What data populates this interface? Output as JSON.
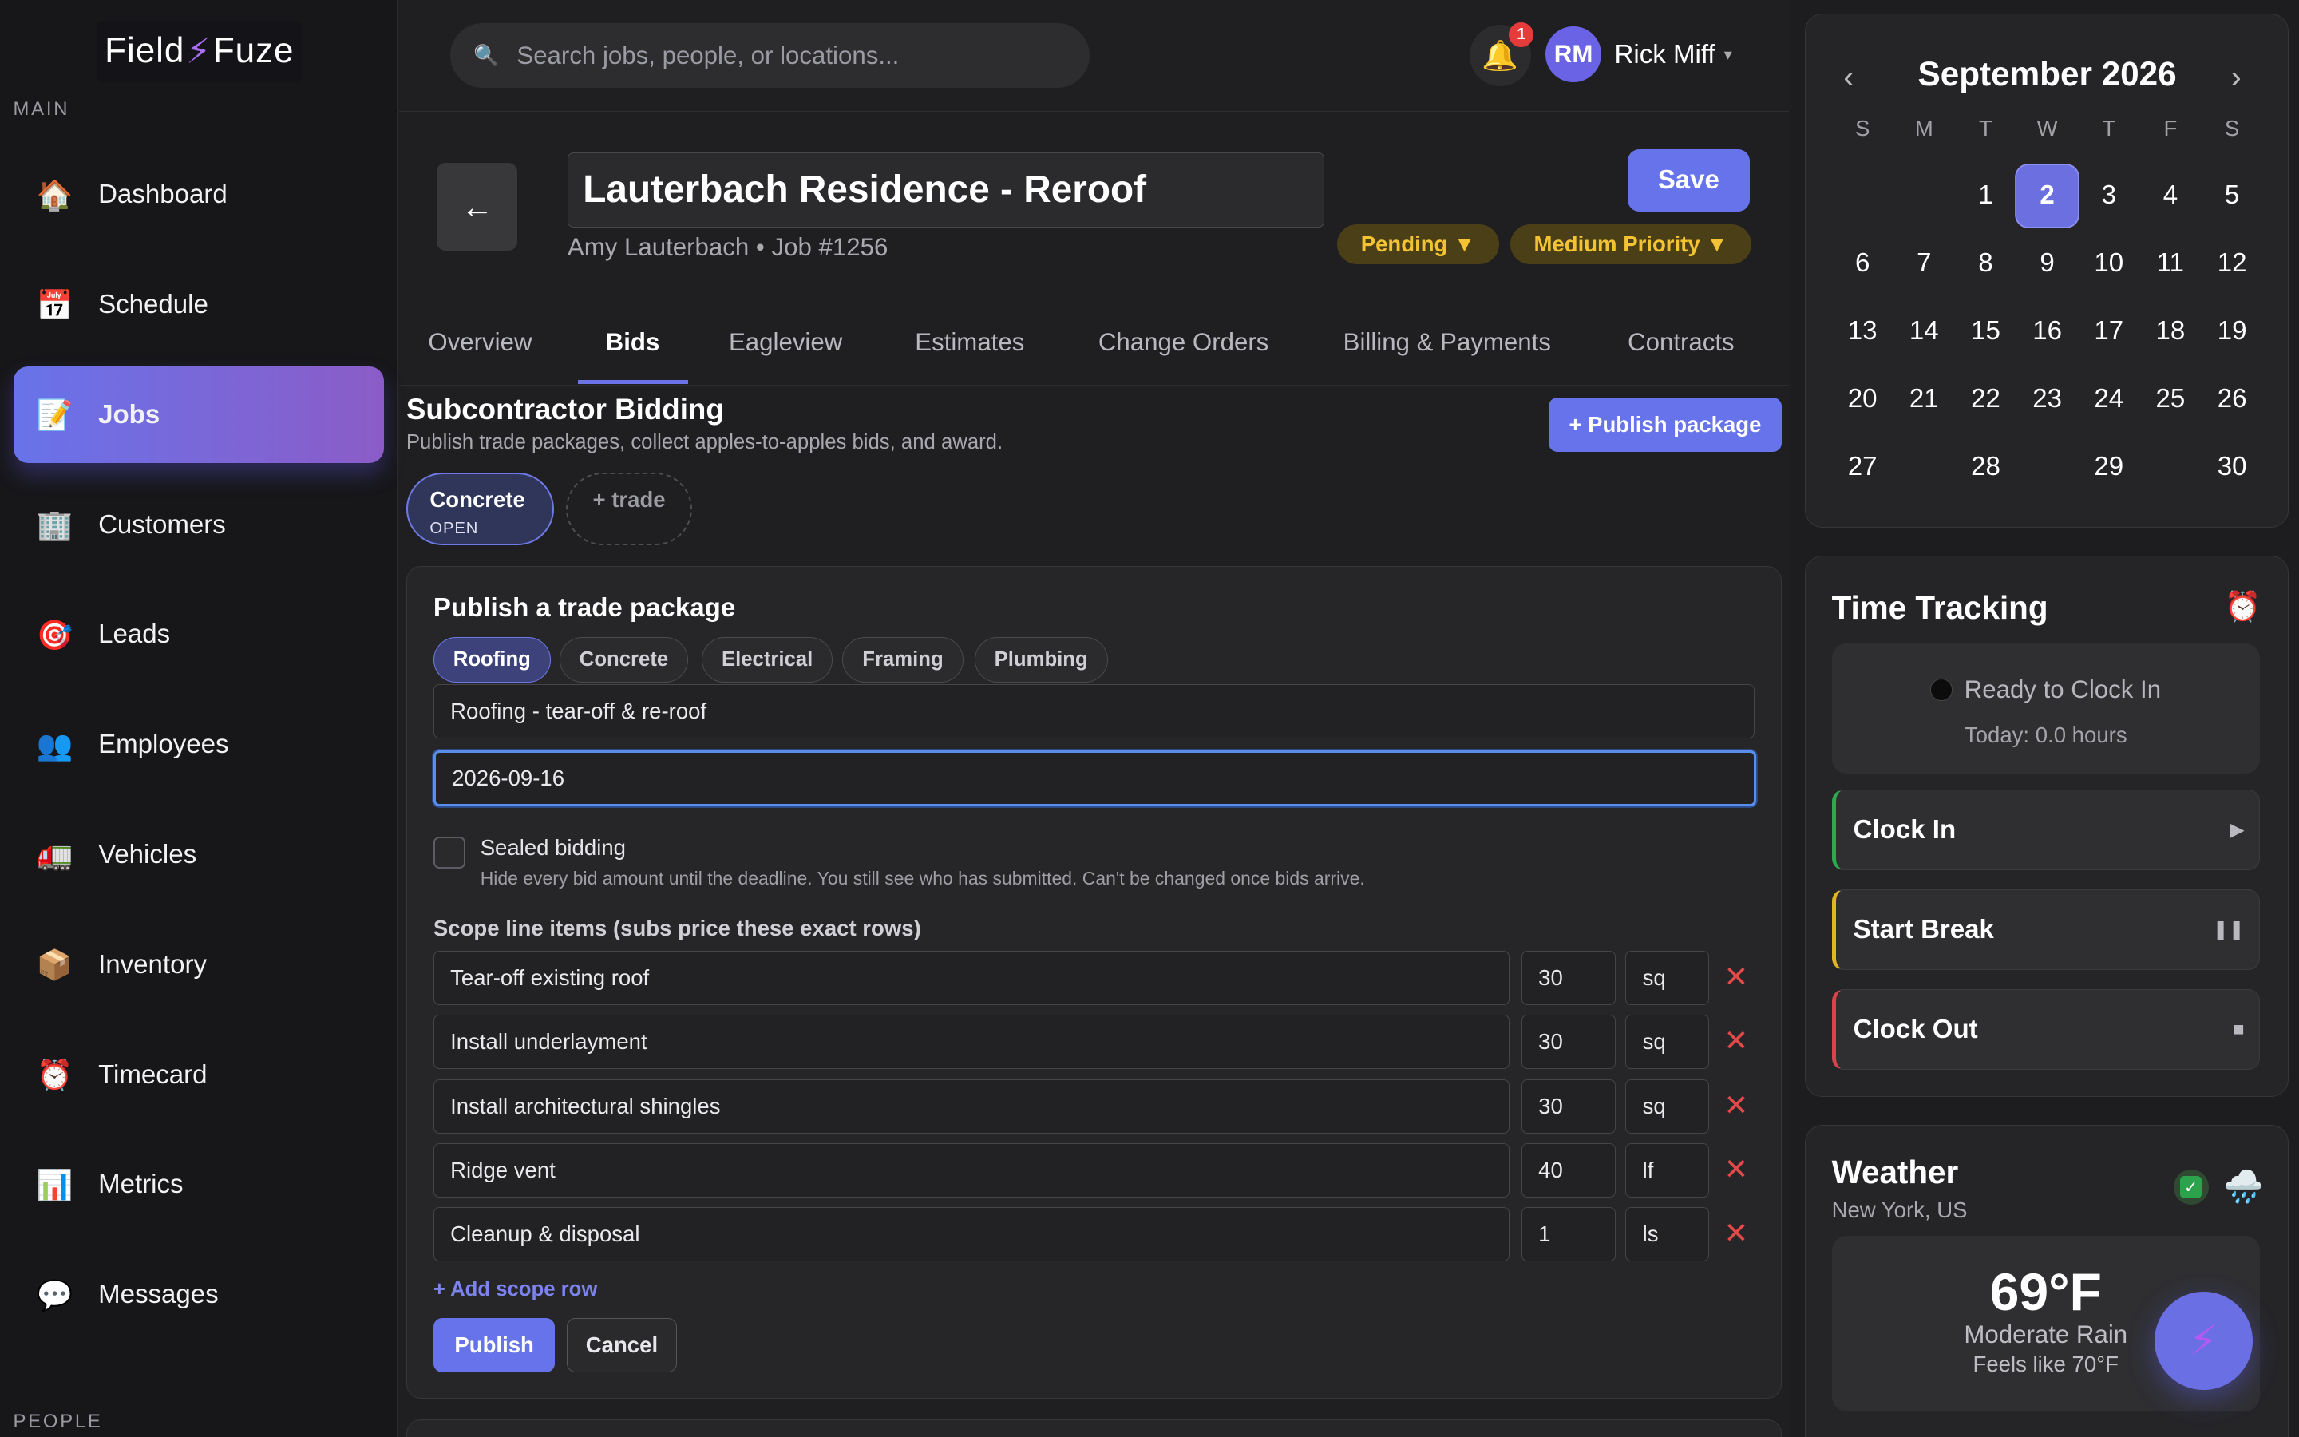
{
  "brand": {
    "logo_left": "Field",
    "logo_bolt": "⚡",
    "logo_right": "Fuze"
  },
  "sidebar": {
    "section_main": "MAIN",
    "section_people": "PEOPLE",
    "items": [
      {
        "label": "Dashboard",
        "icon": "🏠",
        "icon_name": "home-icon"
      },
      {
        "label": "Schedule",
        "icon": "📅",
        "icon_name": "calendar-icon"
      },
      {
        "label": "Jobs",
        "icon": "📝",
        "icon_name": "memo-icon"
      },
      {
        "label": "Customers",
        "icon": "🏢",
        "icon_name": "building-icon"
      },
      {
        "label": "Leads",
        "icon": "🎯",
        "icon_name": "target-icon"
      },
      {
        "label": "Employees",
        "icon": "👥",
        "icon_name": "people-icon"
      },
      {
        "label": "Vehicles",
        "icon": "🚛",
        "icon_name": "truck-icon"
      },
      {
        "label": "Inventory",
        "icon": "📦",
        "icon_name": "box-icon"
      },
      {
        "label": "Timecard",
        "icon": "⏰",
        "icon_name": "alarm-clock-icon"
      },
      {
        "label": "Metrics",
        "icon": "📊",
        "icon_name": "bar-chart-icon"
      },
      {
        "label": "Messages",
        "icon": "💬",
        "icon_name": "speech-bubble-icon"
      }
    ],
    "active": "Jobs"
  },
  "topbar": {
    "search_placeholder": "Search jobs, people, or locations...",
    "notification_count": "1",
    "avatar_initials": "RM",
    "user_name": "Rick Miff",
    "user_caret": "▾"
  },
  "job": {
    "title": "Lauterbach Residence - Reroof",
    "subtitle": "Amy Lauterbach • Job #1256",
    "save_label": "Save",
    "status": "Pending ▼",
    "priority": "Medium Priority ▼",
    "back_icon": "←"
  },
  "tabs": [
    "Overview",
    "Bids",
    "Eagleview",
    "Estimates",
    "Change Orders",
    "Billing & Payments",
    "Contracts"
  ],
  "active_tab": "Bids",
  "bidding": {
    "title": "Subcontractor Bidding",
    "subtitle": "Publish trade packages, collect apples-to-apples bids, and award.",
    "publish_package_label": "+ Publish package",
    "trade_chip_name": "Concrete",
    "trade_chip_status": "OPEN",
    "add_trade_label": "+ trade"
  },
  "publish_form": {
    "title": "Publish a trade package",
    "trade_tabs": [
      "Roofing",
      "Concrete",
      "Electrical",
      "Framing",
      "Plumbing"
    ],
    "active_trade": "Roofing",
    "package_name": "Roofing - tear-off & re-roof",
    "deadline": "2026-09-16",
    "sealed_label": "Sealed bidding",
    "sealed_help": "Hide every bid amount until the deadline. You still see who has submitted. Can't be changed once bids arrive.",
    "sealed_checked": false,
    "scope_label": "Scope line items (subs price these exact rows)",
    "scope_rows": [
      {
        "desc": "Tear-off existing roof",
        "qty": "30",
        "unit": "sq"
      },
      {
        "desc": "Install underlayment",
        "qty": "30",
        "unit": "sq"
      },
      {
        "desc": "Install architectural shingles",
        "qty": "30",
        "unit": "sq"
      },
      {
        "desc": "Ridge vent",
        "qty": "40",
        "unit": "lf"
      },
      {
        "desc": "Cleanup & disposal",
        "qty": "1",
        "unit": "ls"
      }
    ],
    "remove_icon": "✕",
    "add_row_label": "+ Add scope row",
    "publish_label": "Publish",
    "cancel_label": "Cancel"
  },
  "calendar": {
    "month_label": "September 2026",
    "prev_icon": "‹",
    "next_icon": "›",
    "weekdays": [
      "S",
      "M",
      "T",
      "W",
      "T",
      "F",
      "S"
    ],
    "weeks": [
      [
        "",
        "",
        "1",
        "2",
        "3",
        "4",
        "5"
      ],
      [
        "6",
        "7",
        "8",
        "9",
        "10",
        "11",
        "12"
      ],
      [
        "13",
        "14",
        "15",
        "16",
        "17",
        "18",
        "19"
      ],
      [
        "20",
        "21",
        "22",
        "23",
        "24",
        "25",
        "26"
      ],
      [
        "27",
        "28",
        "29",
        "30"
      ]
    ],
    "selected_day": "2"
  },
  "time_tracking": {
    "title": "Time Tracking",
    "alarm_icon": "⏰",
    "status": "Ready to Clock In",
    "today": "Today: 0.0 hours",
    "buttons": [
      {
        "label": "Clock In",
        "symbol": "▶",
        "accent": "#2fa84f"
      },
      {
        "label": "Start Break",
        "symbol": "❚❚",
        "accent": "#e0b622"
      },
      {
        "label": "Clock Out",
        "symbol": "■",
        "accent": "#d9434b"
      }
    ]
  },
  "weather": {
    "title": "Weather",
    "location": "New York, US",
    "check_icon": "✓",
    "cloud_icon": "🌧️",
    "temp": "69°F",
    "condition": "Moderate Rain",
    "feels_like": "Feels like 70°F"
  },
  "fab_icon": "⚡",
  "colors": {
    "accent": "#6673ea",
    "status_yellow": "#f3c334",
    "danger": "#e34a4a"
  }
}
